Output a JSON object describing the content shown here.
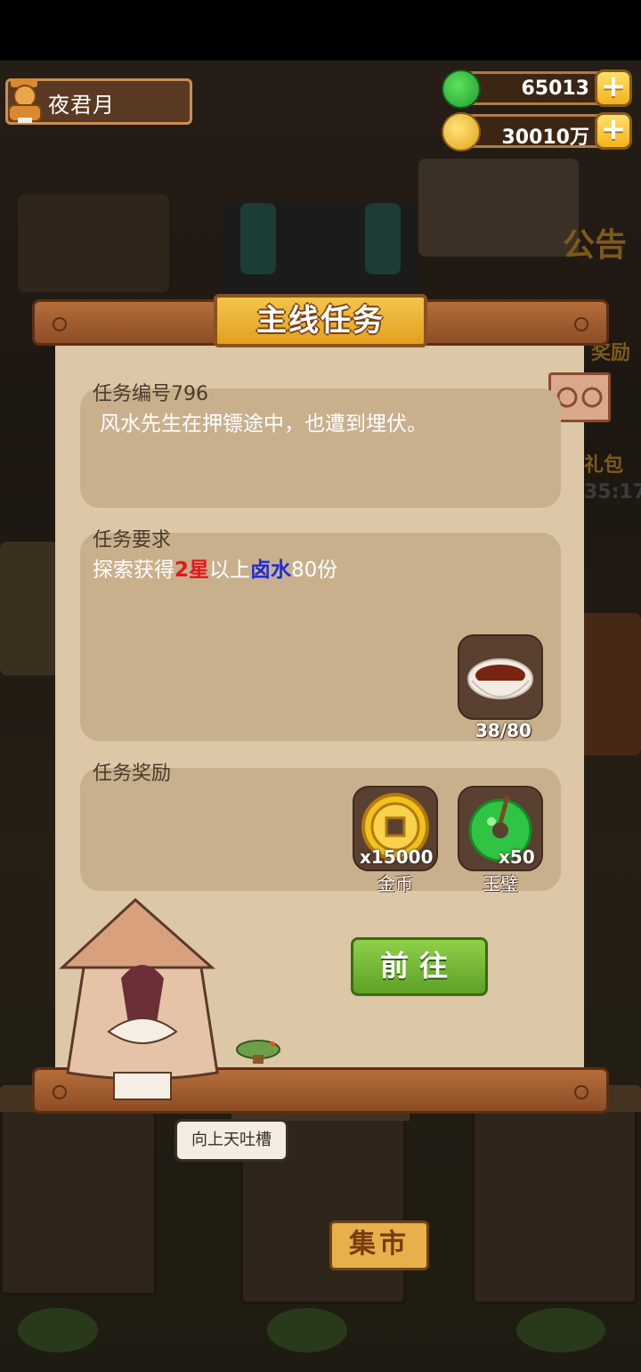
{
  "player": {
    "name": "夜君月"
  },
  "resources": {
    "jade": "65013",
    "gold": "30010万"
  },
  "side_labels": {
    "notice": "公告",
    "reward": "奖励",
    "gift": "礼包",
    "timer": "35:17"
  },
  "panel": {
    "title": "主线任务",
    "task_number": "任务编号796",
    "description": "风水先生在押镖途中，也遭到埋伏。",
    "requirement_label": "任务要求",
    "requirement": {
      "pre": "探索获得",
      "stars": "2星",
      "mid": "以上",
      "item": "卤水",
      "post": "80份"
    },
    "requirement_item": {
      "icon": "brine-bowl-icon",
      "progress": "38/80"
    },
    "reward_label": "任务奖励",
    "rewards": [
      {
        "icon": "gold-coin-icon",
        "count": "x15000",
        "name": "金币"
      },
      {
        "icon": "jade-disc-icon",
        "count": "x50",
        "name": "玉璧"
      }
    ],
    "go_button": "前往"
  },
  "scene": {
    "speech_bubble": "向上天吐槽",
    "market_sign": "集市"
  },
  "colors": {
    "wood": "#8c4d26",
    "paper": "#dcc7a6",
    "section": "#c8b08d",
    "go_green": "#5da126",
    "star_red": "#e8151b",
    "item_blue": "#1e2bd6"
  }
}
